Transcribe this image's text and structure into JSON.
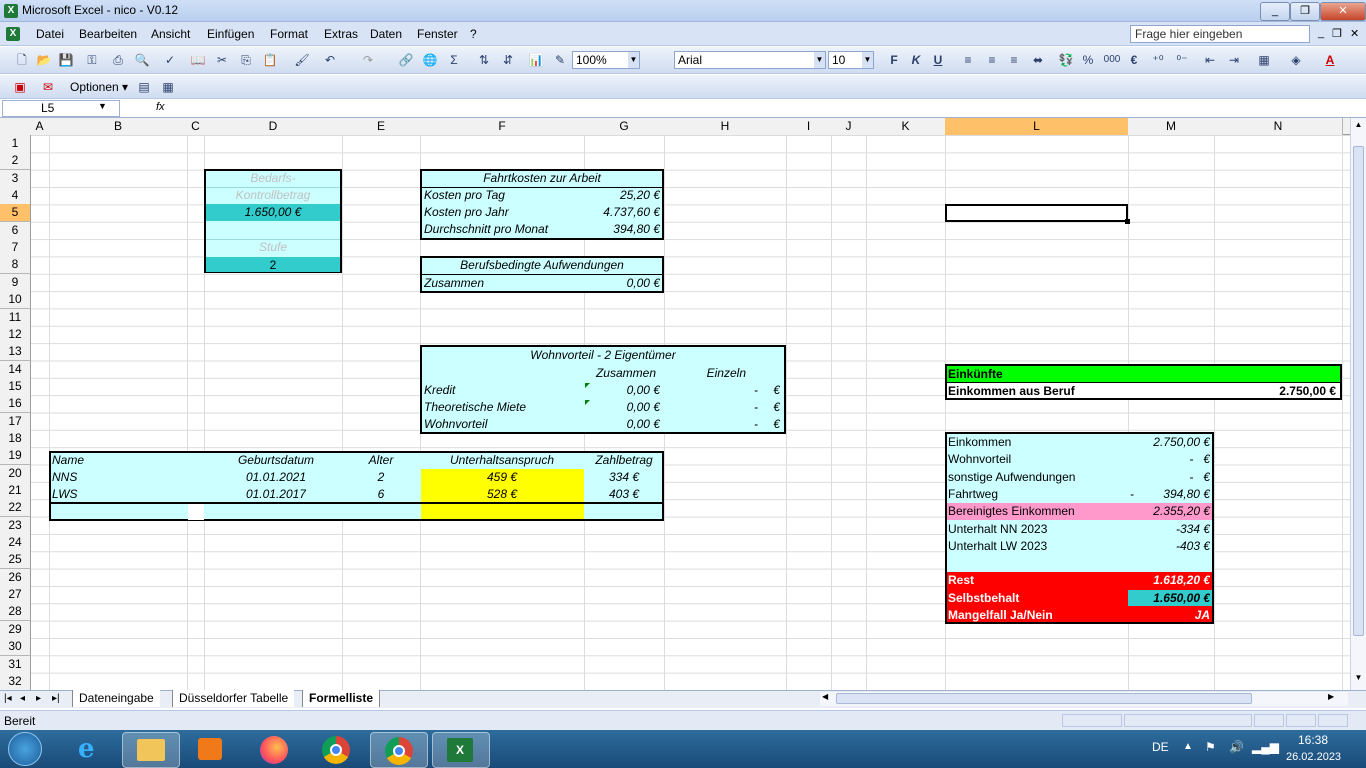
{
  "window": {
    "title": "Microsoft Excel - nico - V0.12",
    "buttons": [
      "_",
      "❐",
      "✕"
    ]
  },
  "menu": {
    "items": [
      "Datei",
      "Bearbeiten",
      "Ansicht",
      "Einfügen",
      "Format",
      "Extras",
      "Daten",
      "Fenster",
      "?"
    ],
    "help_placeholder": "Frage hier eingeben"
  },
  "toolbar": {
    "zoom": "100%",
    "font": "Arial",
    "size": "10",
    "bold": "F",
    "italic": "K",
    "underline": "U",
    "percent": "%",
    "thousands": "000",
    "euro": "€",
    "options_label": "Optionen"
  },
  "formula_bar": {
    "name_box": "L5",
    "fx": "fx",
    "content": ""
  },
  "columns": [
    "A",
    "B",
    "C",
    "D",
    "E",
    "F",
    "G",
    "H",
    "I",
    "J",
    "K",
    "L",
    "M",
    "N"
  ],
  "rows": [
    "1",
    "2",
    "3",
    "4",
    "5",
    "6",
    "7",
    "8",
    "9",
    "10",
    "11",
    "12",
    "13",
    "14",
    "15",
    "16",
    "17",
    "18",
    "19",
    "20",
    "21",
    "22",
    "23",
    "24",
    "25",
    "26",
    "27",
    "28",
    "29",
    "30",
    "31",
    "32"
  ],
  "selected": {
    "column": "L",
    "row": "5"
  },
  "bedarf": {
    "line1": "Bedarfs-",
    "line2": "Kontrollbetrag",
    "value": "1.650,00 €",
    "stufe_label": "Stufe",
    "stufe_value": "2"
  },
  "fahrtkosten": {
    "title": "Fahrtkosten zur Arbeit",
    "rows": [
      {
        "label": "Kosten pro Tag",
        "value": "25,20 €"
      },
      {
        "label": "Kosten pro Jahr",
        "value": "4.737,60 €"
      },
      {
        "label": "Durchschnitt pro Monat",
        "value": "394,80 €"
      }
    ]
  },
  "berufsbedingt": {
    "title": "Berufsbedingte Aufwendungen",
    "label": "Zusammen",
    "value": "0,00 €"
  },
  "wohnvorteil": {
    "title": "Wohnvorteil - 2 Eigentümer",
    "col_zusammen": "Zusammen",
    "col_einzeln": "Einzeln",
    "rows": [
      {
        "label": "Kredit",
        "zusammen": "0,00 €",
        "einzeln": "-",
        "cur": "€"
      },
      {
        "label": "Theoretische Miete",
        "zusammen": "0,00 €",
        "einzeln": "-",
        "cur": "€"
      },
      {
        "label": "Wohnvorteil",
        "zusammen": "0,00 €",
        "einzeln": "-",
        "cur": "€"
      }
    ]
  },
  "kinder": {
    "headers": {
      "name": "Name",
      "geburt": "Geburtsdatum",
      "alter": "Alter",
      "anspruch": "Unterhaltsanspruch",
      "zahl": "Zahlbetrag"
    },
    "rows": [
      {
        "name": "NNS",
        "geburt": "01.01.2021",
        "alter": "2",
        "anspruch": "459 €",
        "zahl": "334 €"
      },
      {
        "name": "LWS",
        "geburt": "01.01.2017",
        "alter": "6",
        "anspruch": "528 €",
        "zahl": "403 €"
      }
    ]
  },
  "einkuenfte": {
    "title": "Einkünfte",
    "label": "Einkommen aus Beruf",
    "value": "2.750,00 €"
  },
  "berechnung": {
    "rows": [
      {
        "label": "Einkommen",
        "pre": "",
        "value": "2.750,00 €"
      },
      {
        "label": "Wohnvorteil",
        "pre": "",
        "value": "-   €"
      },
      {
        "label": "sonstige Aufwendungen",
        "pre": "",
        "value": "-   €"
      },
      {
        "label": "Fahrtweg",
        "pre": "-",
        "value": "394,80 €"
      }
    ],
    "bereinigt_label": "Bereinigtes Einkommen",
    "bereinigt_value": "2.355,20 €",
    "unterhalt": [
      {
        "label": "Unterhalt NN 2023",
        "value": "-334 €"
      },
      {
        "label": "Unterhalt LW 2023",
        "value": "-403 €"
      }
    ],
    "rest_label": "Rest",
    "rest_value": "1.618,20 €",
    "selbst_label": "Selbstbehalt",
    "selbst_value": "1.650,00 €",
    "mangel_label": "Mangelfall Ja/Nein",
    "mangel_value": "JA"
  },
  "sheets": {
    "tabs": [
      "Dateneingabe",
      "Düsseldorfer Tabelle",
      "Formelliste"
    ],
    "active": "Formelliste"
  },
  "status": {
    "text": "Bereit"
  },
  "taskbar": {
    "lang": "DE",
    "time": "16:38",
    "date": "26.02.2023"
  },
  "colors": {
    "cyan": "#ccffff",
    "teal": "#33cccc",
    "yellow": "#ffff00",
    "red": "#ff0000",
    "pink": "#ff99cc",
    "green": "#00ff00",
    "selected_header": "#ffc06a"
  }
}
